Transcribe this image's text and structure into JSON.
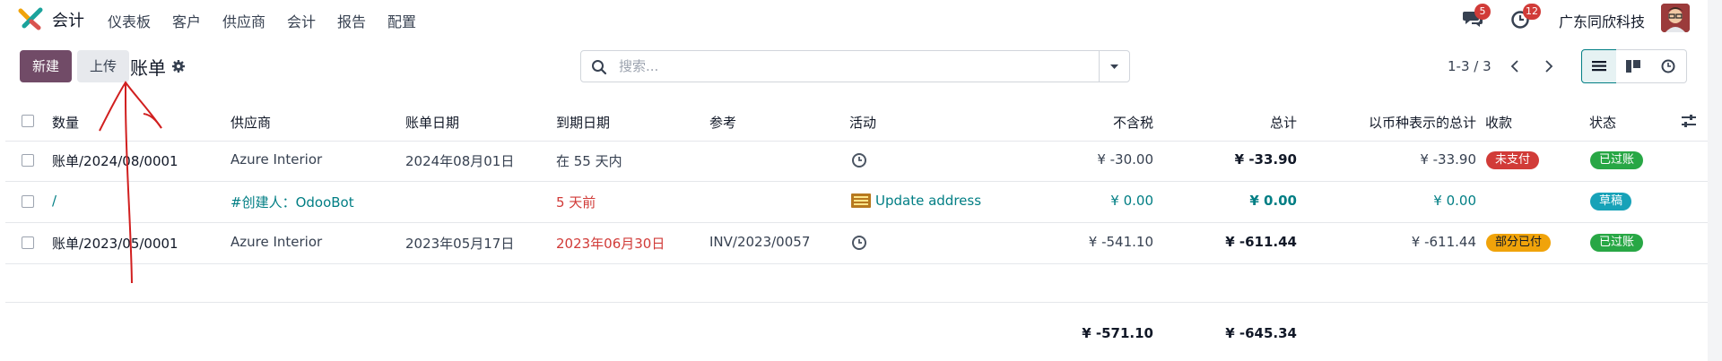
{
  "navbar": {
    "app_title": "会计",
    "menu": [
      "仪表板",
      "客户",
      "供应商",
      "会计",
      "报告",
      "配置"
    ],
    "messages_badge": "5",
    "activities_badge": "12",
    "company": "广东同欣科技"
  },
  "control": {
    "new_label": "新建",
    "upload_label": "上传",
    "breadcrumb": "账单",
    "search_placeholder": "搜索...",
    "pager": "1-3 / 3"
  },
  "table": {
    "headers": {
      "quantity": "数量",
      "vendor": "供应商",
      "bill_date": "账单日期",
      "due_date": "到期日期",
      "reference": "参考",
      "activity": "活动",
      "untaxed": "不含税",
      "total": "总计",
      "total_currency": "以币种表示的总计",
      "payment": "收款",
      "status": "状态"
    },
    "rows": [
      {
        "number": "账单/2024/08/0001",
        "vendor": "Azure Interior",
        "bill_date": "2024年08月01日",
        "due_date": "在 55 天内",
        "reference": "",
        "activity": "",
        "untaxed": "¥ -30.00",
        "total": "¥ -33.90",
        "total_currency": "¥ -33.90",
        "payment": "未支付",
        "status": "已过账"
      },
      {
        "number": "/",
        "vendor": "#创建人：OdooBot",
        "bill_date": "",
        "due_date": "5 天前",
        "reference": "",
        "activity": "Update address",
        "untaxed": "¥ 0.00",
        "total": "¥ 0.00",
        "total_currency": "¥ 0.00",
        "payment": "",
        "status": "草稿"
      },
      {
        "number": "账单/2023/05/0001",
        "vendor": "Azure Interior",
        "bill_date": "2023年05月17日",
        "due_date": "2023年06月30日",
        "reference": "INV/2023/0057",
        "activity": "",
        "untaxed": "¥ -541.10",
        "total": "¥ -611.44",
        "total_currency": "¥ -611.44",
        "payment": "部分已付",
        "status": "已过账"
      }
    ],
    "totals": {
      "untaxed": "¥ -571.10",
      "total": "¥ -645.34"
    }
  },
  "colors": {
    "brand": "#714b67",
    "teal": "#017e84",
    "danger": "#d13b38",
    "success": "#28a745",
    "warning": "#f0a30a",
    "info": "#17a2b8"
  }
}
